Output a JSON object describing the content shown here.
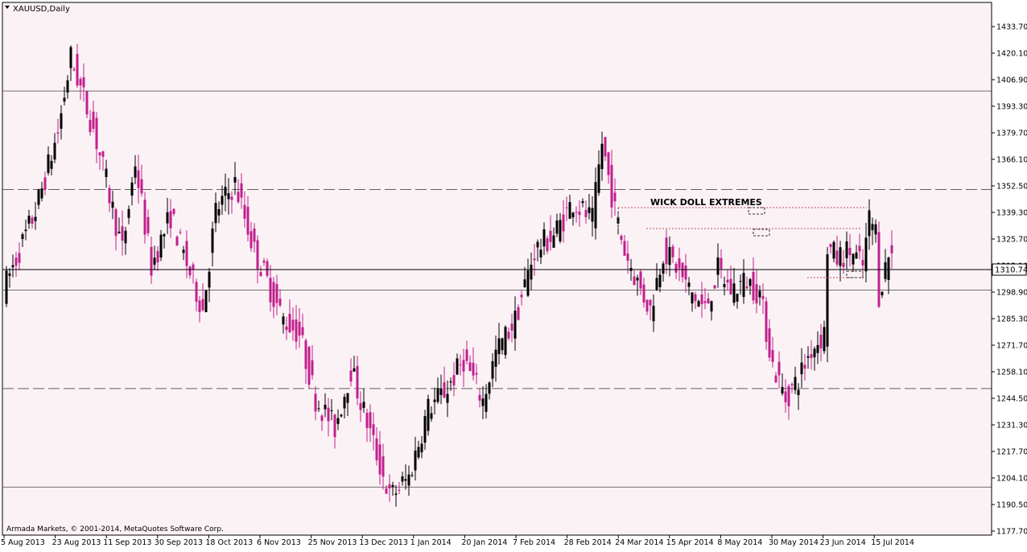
{
  "title": "XAUUSD,Daily",
  "copyright": "Armada Markets, © 2001-2014, MetaQuotes Software Corp.",
  "annotation": "WICK DOLL EXTREMES",
  "current_price_label": "1310.74",
  "colors": {
    "background": "#fbf2f6",
    "bull_candle": "#000000",
    "bear_candle": "#c0208c",
    "solid_level": "#707070",
    "dashed_level": "#606060",
    "annotation_dotted": "#c05050",
    "current_price_line": "#000000"
  },
  "chart_data": {
    "type": "candlestick",
    "symbol": "XAUUSD",
    "timeframe": "Daily",
    "ylim": [
      1177.7,
      1433.7
    ],
    "y_ticks": [
      "1433.70",
      "1420.10",
      "1406.90",
      "1393.30",
      "1379.70",
      "1366.10",
      "1352.50",
      "1339.30",
      "1325.70",
      "1312.10",
      "1298.90",
      "1285.30",
      "1271.70",
      "1258.10",
      "1244.50",
      "1231.30",
      "1217.70",
      "1204.10",
      "1190.50",
      "1177.70"
    ],
    "x_labels": [
      "5 Aug 2013",
      "23 Aug 2013",
      "11 Sep 2013",
      "30 Sep 2013",
      "18 Oct 2013",
      "6 Nov 2013",
      "25 Nov 2013",
      "13 Dec 2013",
      "1 Jan 2014",
      "20 Jan 2014",
      "7 Feb 2014",
      "28 Feb 2014",
      "24 Mar 2014",
      "15 Apr 2014",
      "8 May 2014",
      "30 May 2014",
      "23 Jun 2014",
      "15 Jul 2014"
    ],
    "horizontal_levels": [
      {
        "price": 1401.0,
        "style": "solid"
      },
      {
        "price": 1351.0,
        "style": "dashed"
      },
      {
        "price": 1300.0,
        "style": "solid"
      },
      {
        "price": 1250.0,
        "style": "dashed"
      },
      {
        "price": 1200.0,
        "style": "solid"
      }
    ],
    "current_price": 1310.74,
    "key_points": [
      {
        "label": "23 Aug 2013",
        "price": 1433.7,
        "kind": "swing high"
      },
      {
        "label": "13 Dec 2013",
        "price": 1181.0,
        "kind": "swing low"
      },
      {
        "label": "28 Feb 2014",
        "price": 1391.0,
        "kind": "swing high"
      },
      {
        "label": "30 May 2014",
        "price": 1240.0,
        "kind": "swing low"
      },
      {
        "label": "15 Jul 2014",
        "price": 1345.0,
        "kind": "swing high"
      }
    ]
  }
}
